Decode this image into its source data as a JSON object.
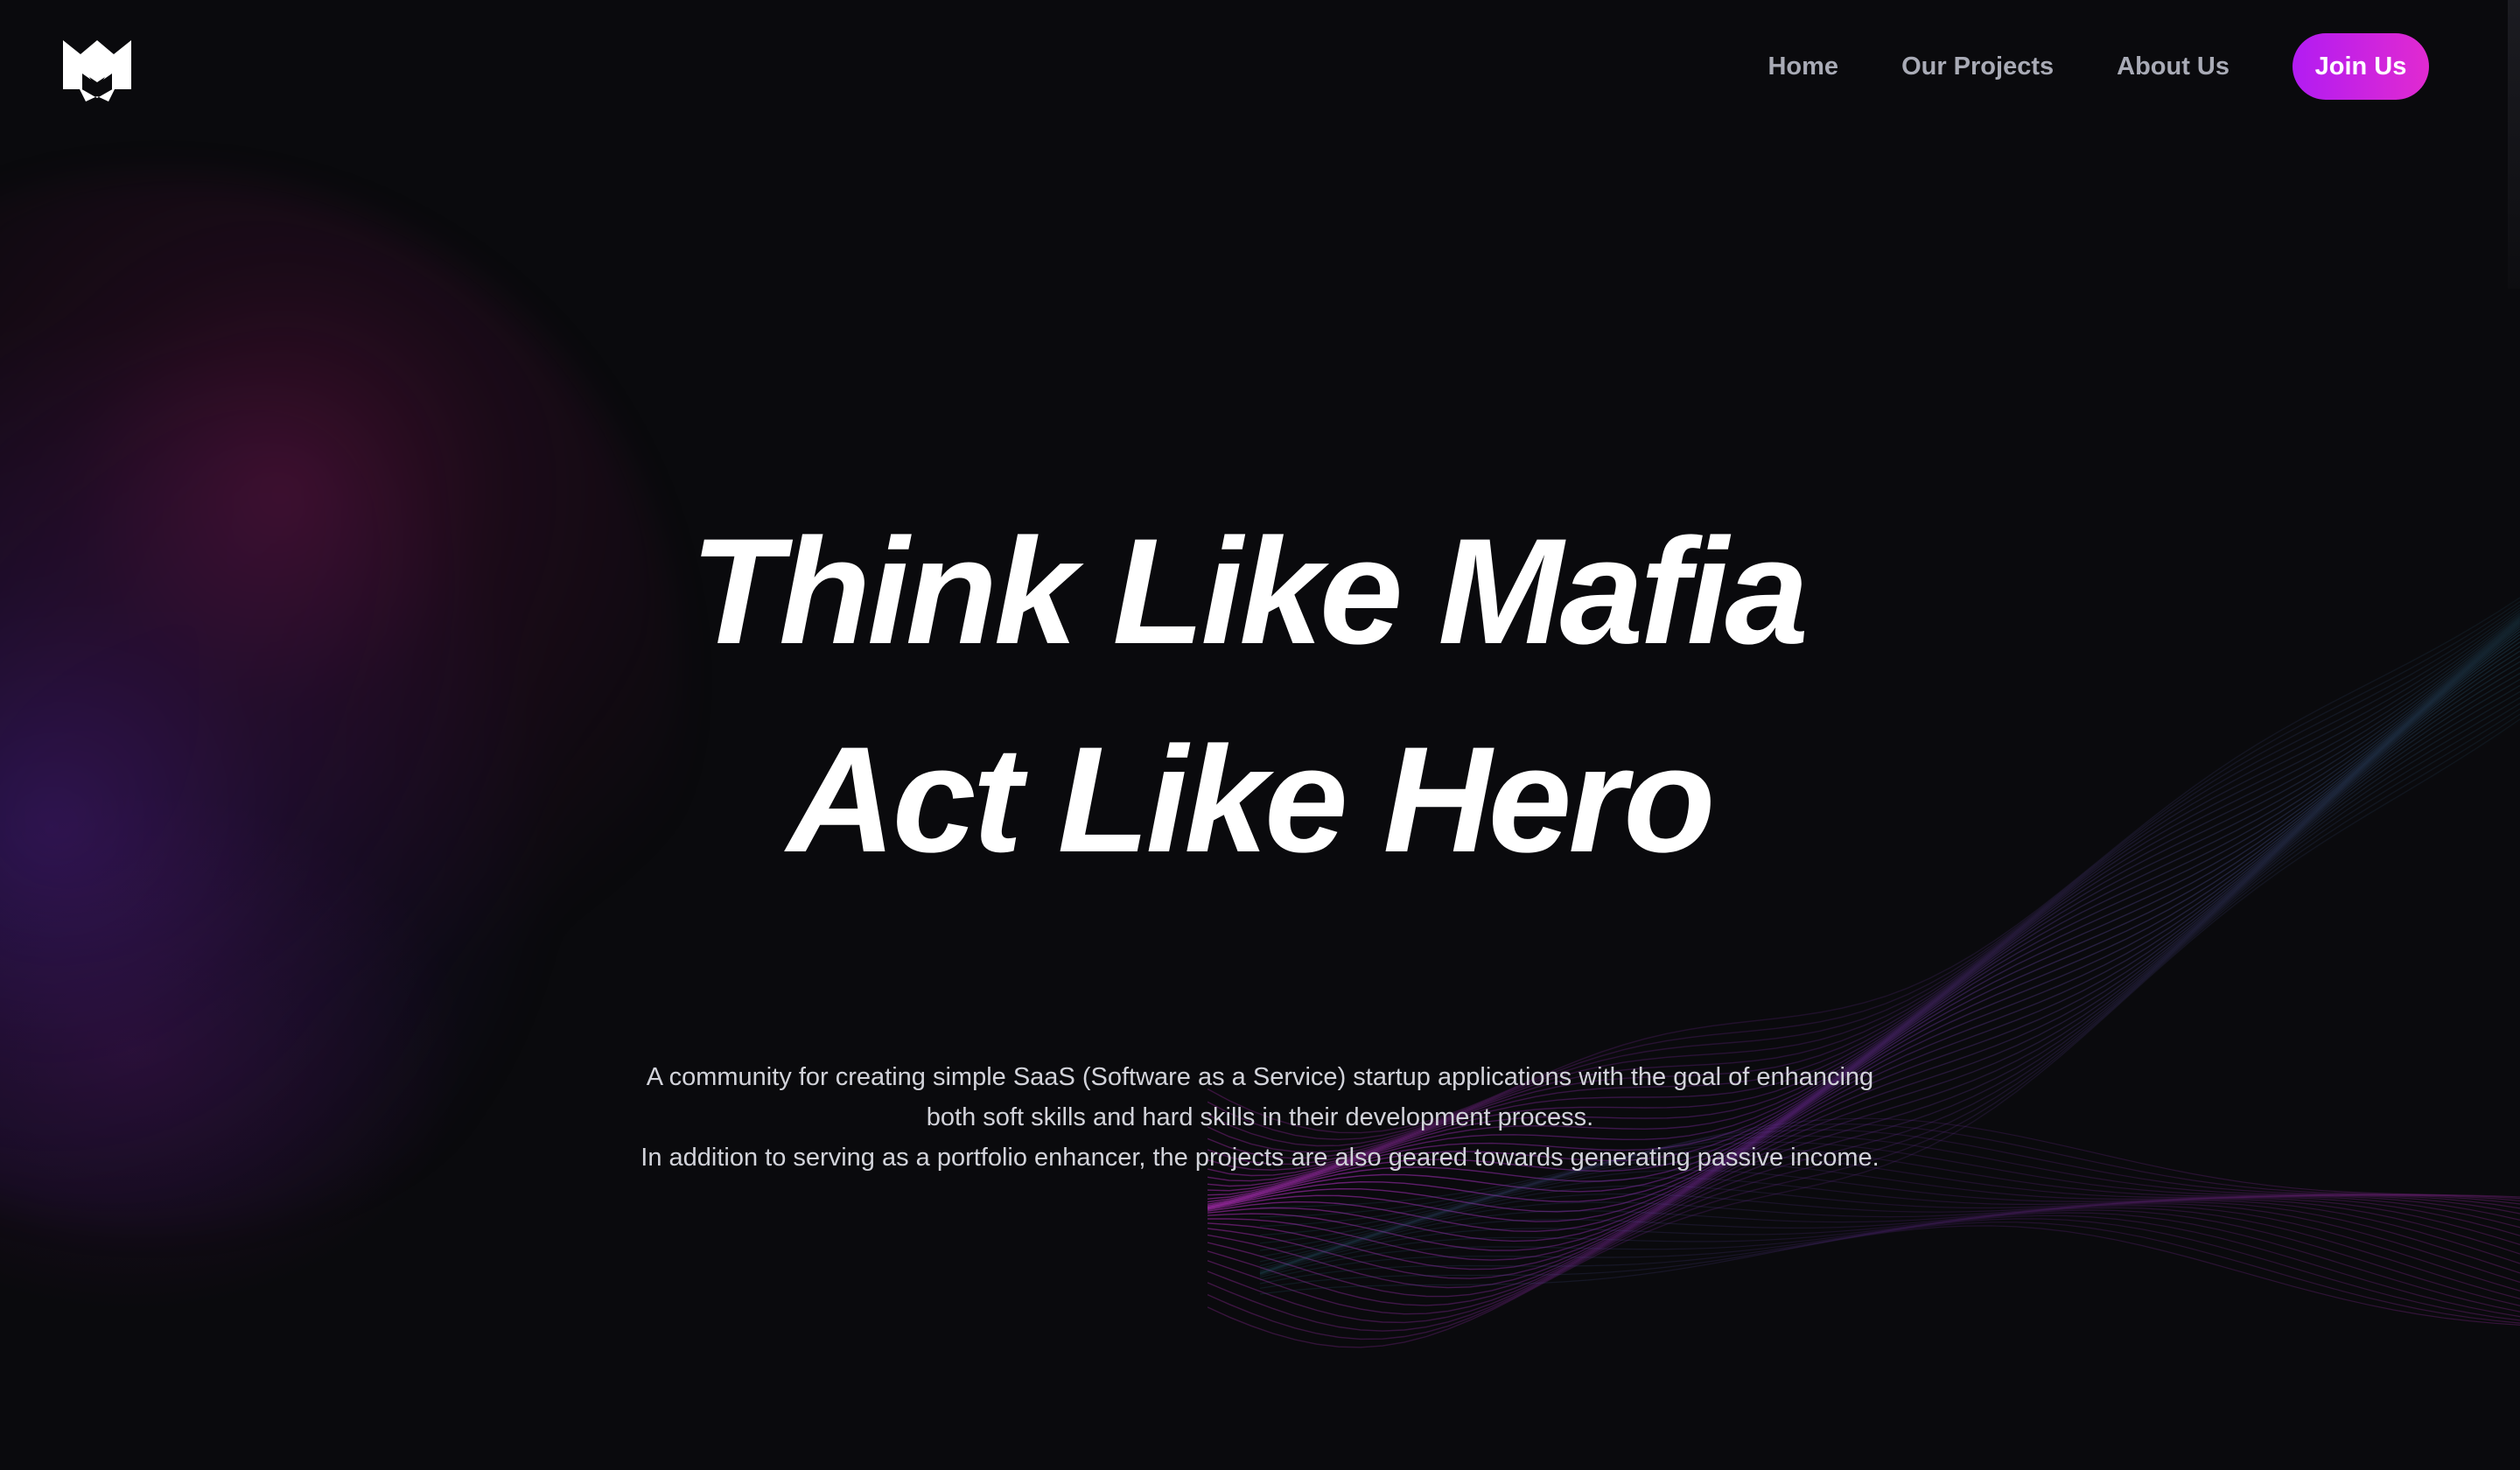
{
  "brand": {
    "logo_icon": "mafia-m-logo-icon"
  },
  "nav": {
    "items": [
      {
        "label": "Home"
      },
      {
        "label": "Our Projects"
      },
      {
        "label": "About Us"
      }
    ],
    "cta_label": "Join Us"
  },
  "hero": {
    "title_line_1": "Think Like Mafia",
    "title_line_2": "Act Like Hero",
    "description_para_1": "A community for creating simple SaaS (Software as a Service) startup applications with the goal of enhancing both soft skills and hard skills in their development process.",
    "description_para_2": "In addition to serving as a portfolio enhancer, the projects are also geared towards generating passive income."
  },
  "colors": {
    "background": "#0a0a0d",
    "nav_text": "#a9abb6",
    "cta_gradient_start": "#b21cf2",
    "cta_gradient_end": "#e12ad0",
    "mesh_magenta": "#b02ac0",
    "mesh_teal": "#2a6a86",
    "glow_purple": "#46208c"
  }
}
